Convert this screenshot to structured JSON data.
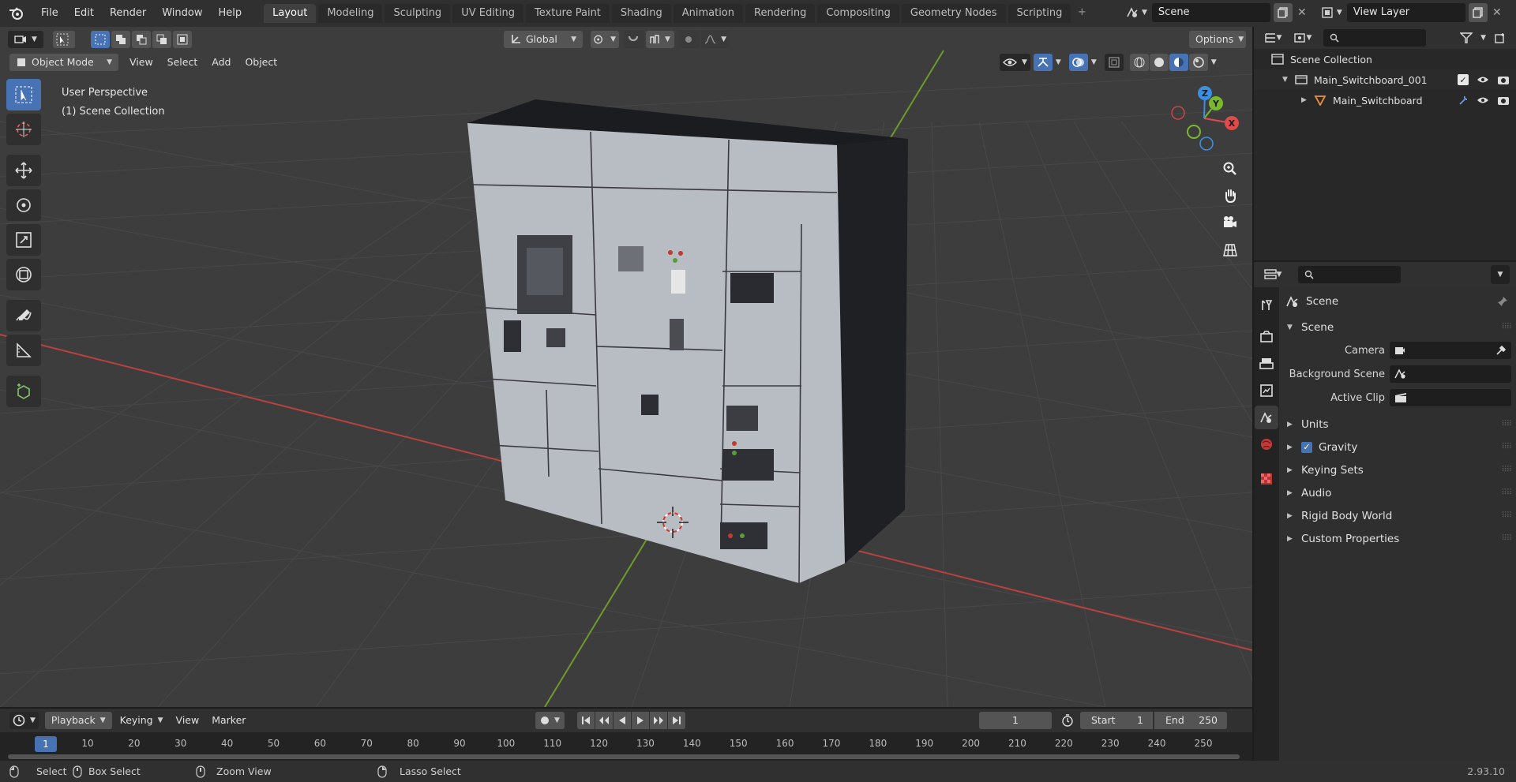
{
  "menu": [
    "File",
    "Edit",
    "Render",
    "Window",
    "Help"
  ],
  "workspaces": [
    "Layout",
    "Modeling",
    "Sculpting",
    "UV Editing",
    "Texture Paint",
    "Shading",
    "Animation",
    "Rendering",
    "Compositing",
    "Geometry Nodes",
    "Scripting"
  ],
  "active_workspace": "Layout",
  "scene_name": "Scene",
  "view_layer": "View Layer",
  "viewport": {
    "transform_orientation": "Global",
    "options_label": "Options",
    "mode": "Object Mode",
    "header_menu": [
      "View",
      "Select",
      "Add",
      "Object"
    ],
    "perspective_text": "User Perspective",
    "collection_text": "(1) Scene Collection",
    "gizmo": {
      "x": "X",
      "y": "Y",
      "z": "Z"
    }
  },
  "outliner": {
    "root": "Scene Collection",
    "collection": "Main_Switchboard_001",
    "object": "Main_Switchboard"
  },
  "properties": {
    "context_title": "Scene",
    "panel_title": "Scene",
    "camera_label": "Camera",
    "bg_scene_label": "Background Scene",
    "active_clip_label": "Active Clip",
    "sections": [
      "Units",
      "Gravity",
      "Keying Sets",
      "Audio",
      "Rigid Body World",
      "Custom Properties"
    ]
  },
  "timeline": {
    "menu": [
      "Playback",
      "Keying",
      "View",
      "Marker"
    ],
    "current_frame": "1",
    "start_label": "Start",
    "start": "1",
    "end_label": "End",
    "end": "250",
    "ticks": [
      "1",
      "10",
      "20",
      "30",
      "40",
      "50",
      "60",
      "70",
      "80",
      "90",
      "100",
      "110",
      "120",
      "130",
      "140",
      "150",
      "160",
      "170",
      "180",
      "190",
      "200",
      "210",
      "220",
      "230",
      "240",
      "250"
    ]
  },
  "status": {
    "select": "Select",
    "box_select": "Box Select",
    "zoom_view": "Zoom View",
    "lasso_select": "Lasso Select",
    "version": "2.93.10"
  },
  "colors": {
    "accent": "#4772b3",
    "axis_x": "#e04a4a",
    "axis_y": "#7ab82f",
    "axis_z": "#3b8fe0"
  }
}
